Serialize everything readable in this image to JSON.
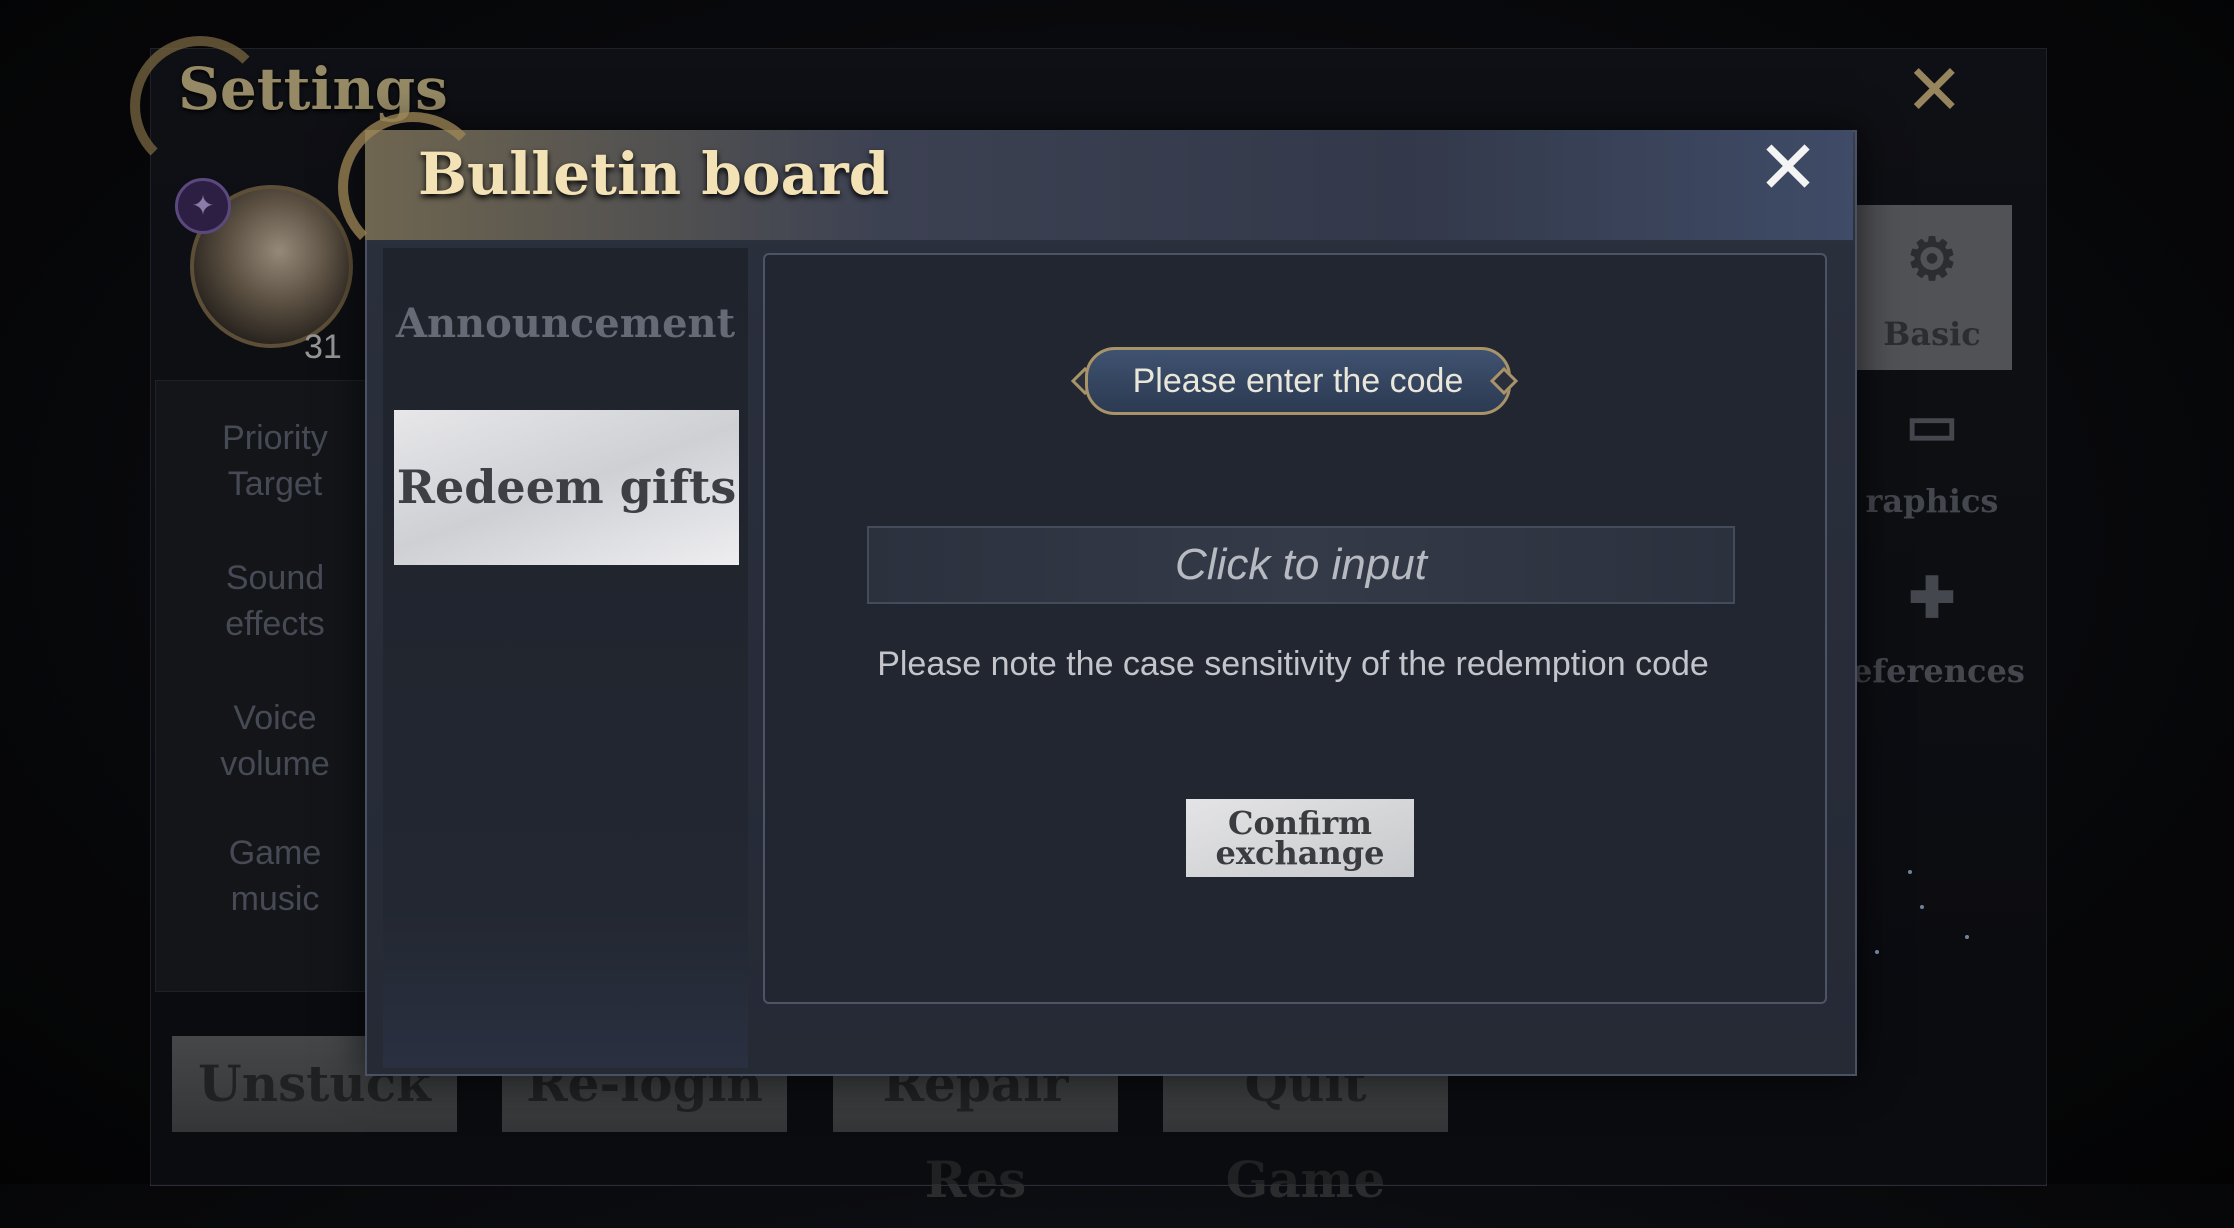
{
  "settings": {
    "title": "Settings",
    "player_level": "31",
    "sidebar": [
      {
        "label": "Priority\nTarget"
      },
      {
        "label": "Sound\neffects"
      },
      {
        "label": "Voice\nvolume"
      },
      {
        "label": "Game\nmusic"
      }
    ],
    "right_tabs": [
      {
        "label": "Basic",
        "icon": "gear-icon"
      },
      {
        "label": "raphics",
        "icon": "monitor-icon"
      },
      {
        "label": "eferences",
        "icon": "gamepad-icon"
      }
    ],
    "bottom_buttons": [
      "Unstuck",
      "Re-login",
      "Repair Res",
      "Quit Game"
    ]
  },
  "dialog": {
    "title": "Bulletin board",
    "tabs": {
      "announcement": "Announcement",
      "redeem": "Redeem gifts"
    },
    "code_prompt": "Please enter the code",
    "input_placeholder": "Click to input",
    "note": "Please note the case sensitivity of the redemption code",
    "confirm_label": "Confirm exchange"
  },
  "colors": {
    "gold_accent": "#a89468",
    "title_gold": "#f2e2b6",
    "panel_bg": "#222631",
    "selected_tab": "#e7e7ea"
  }
}
